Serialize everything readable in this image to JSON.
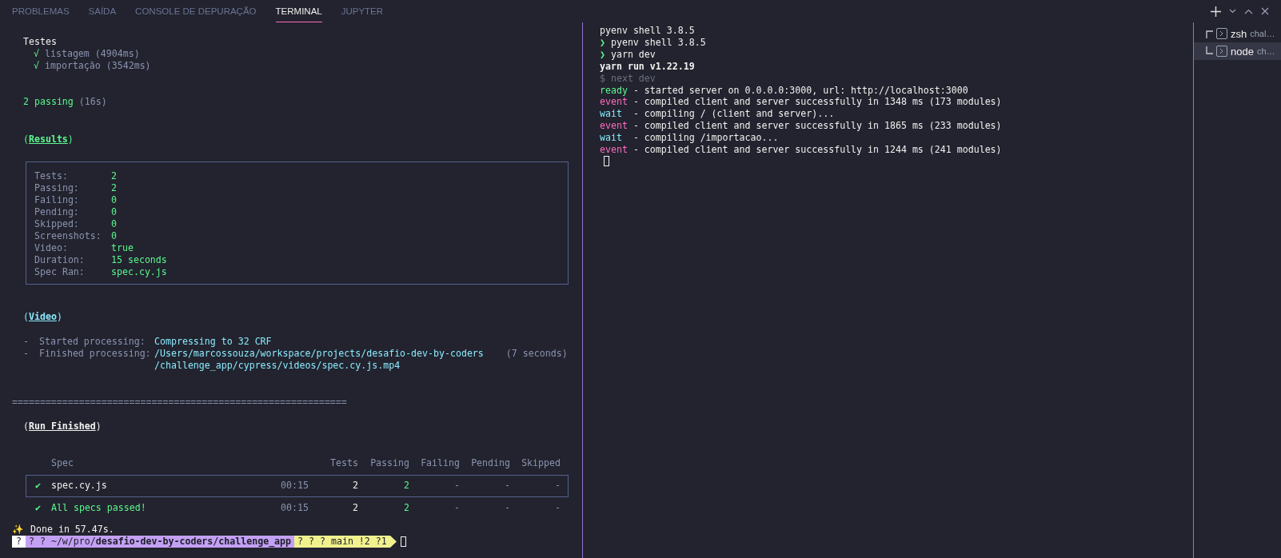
{
  "tabs": [
    {
      "label": "PROBLEMAS",
      "selected": false
    },
    {
      "label": "SAÍDA",
      "selected": false
    },
    {
      "label": "CONSOLE DE DEPURAÇÃO",
      "selected": false
    },
    {
      "label": "TERMINAL",
      "selected": true
    },
    {
      "label": "JUPYTER",
      "selected": false
    }
  ],
  "left_terminal": {
    "tests": {
      "title": "Testes",
      "items": [
        {
          "mark": "√",
          "text": "listagem (4904ms)"
        },
        {
          "mark": "√",
          "text": "importação (3542ms)"
        }
      ]
    },
    "passing": {
      "count": "2 passing",
      "duration": "(16s)"
    },
    "results": {
      "open": "(",
      "heading": "Results",
      "close": ")",
      "rows": [
        {
          "label": "Tests:",
          "value": "2"
        },
        {
          "label": "Passing:",
          "value": "2"
        },
        {
          "label": "Failing:",
          "value": "0"
        },
        {
          "label": "Pending:",
          "value": "0"
        },
        {
          "label": "Skipped:",
          "value": "0"
        },
        {
          "label": "Screenshots:",
          "value": "0"
        },
        {
          "label": "Video:",
          "value": "true"
        },
        {
          "label": "Duration:",
          "value": "15 seconds"
        },
        {
          "label": "Spec Ran:",
          "value": "spec.cy.js"
        }
      ]
    },
    "video": {
      "open": "(",
      "heading": "Video",
      "close": ")",
      "rows": [
        {
          "bullet": "-",
          "label": "Started processing:",
          "value": [
            "Compressing to 32 CRF"
          ]
        },
        {
          "bullet": "-",
          "label": "Finished processing:",
          "value": [
            "/Users/marcossouza/workspace/projects/desafio-dev-by-coders",
            "/challenge_app/cypress/videos/spec.cy.js.mp4"
          ],
          "note": "(7 seconds)"
        }
      ]
    },
    "separator": "============================================================",
    "run_finished": {
      "open": "(",
      "heading": "Run Finished",
      "close": ")",
      "columns": [
        "Spec",
        "Tests",
        "Passing",
        "Failing",
        "Pending",
        "Skipped"
      ],
      "rows": [
        {
          "kind": "spec",
          "mark": "✔",
          "spec": "spec.cy.js",
          "time": "00:15",
          "tests": "2",
          "passing": "2",
          "failing": "-",
          "pending": "-",
          "skipped": "-"
        },
        {
          "kind": "summary",
          "mark": "✔",
          "spec": "All specs passed!",
          "time": "00:15",
          "tests": "2",
          "passing": "2",
          "failing": "-",
          "pending": "-",
          "skipped": "-"
        }
      ]
    },
    "done": {
      "icon": "✨",
      "text": "Done in 57.47s."
    },
    "prompt": {
      "segments": [
        {
          "text": "?",
          "color": "#ffffff"
        },
        {
          "text": "? ? ~/w/pro/**desafio-dev-by-coders/challenge_app**",
          "color": "#c4a0f5"
        },
        {
          "text": "? ? ? main !2 ?1",
          "color": "#f1f28e"
        }
      ]
    }
  },
  "right_terminal": {
    "lines": [
      {
        "kind": "plain",
        "text": "pyenv shell 3.8.5"
      },
      {
        "kind": "prompt",
        "mark": "❯",
        "text": "pyenv shell 3.8.5"
      },
      {
        "kind": "prompt",
        "mark": "❯",
        "text": "yarn dev"
      },
      {
        "kind": "bold",
        "text": "yarn run v1.22.19"
      },
      {
        "kind": "dim",
        "text": "$ next dev"
      },
      {
        "kind": "log",
        "tag": "ready",
        "color": "#5af78e",
        "text": " - started server on 0.0.0.0:3000, url: http://localhost:3000"
      },
      {
        "kind": "log",
        "tag": "event",
        "color": "#ff6ac1",
        "text": " - compiled client and server successfully in 1348 ms (173 modules)"
      },
      {
        "kind": "log",
        "tag": "wait",
        "color": "#8be9fd",
        "text": "  - compiling / (client and server)..."
      },
      {
        "kind": "log",
        "tag": "event",
        "color": "#ff6ac1",
        "text": " - compiled client and server successfully in 1865 ms (233 modules)"
      },
      {
        "kind": "log",
        "tag": "wait",
        "color": "#8be9fd",
        "text": "  - compiling /importacao..."
      },
      {
        "kind": "log",
        "tag": "event",
        "color": "#ff6ac1",
        "text": " - compiled client and server successfully in 1244 ms (241 modules)"
      }
    ]
  },
  "terminal_list": [
    {
      "name": "zsh",
      "detail": "chal…",
      "selected": false
    },
    {
      "name": "node",
      "detail": "ch…",
      "selected": true
    }
  ]
}
